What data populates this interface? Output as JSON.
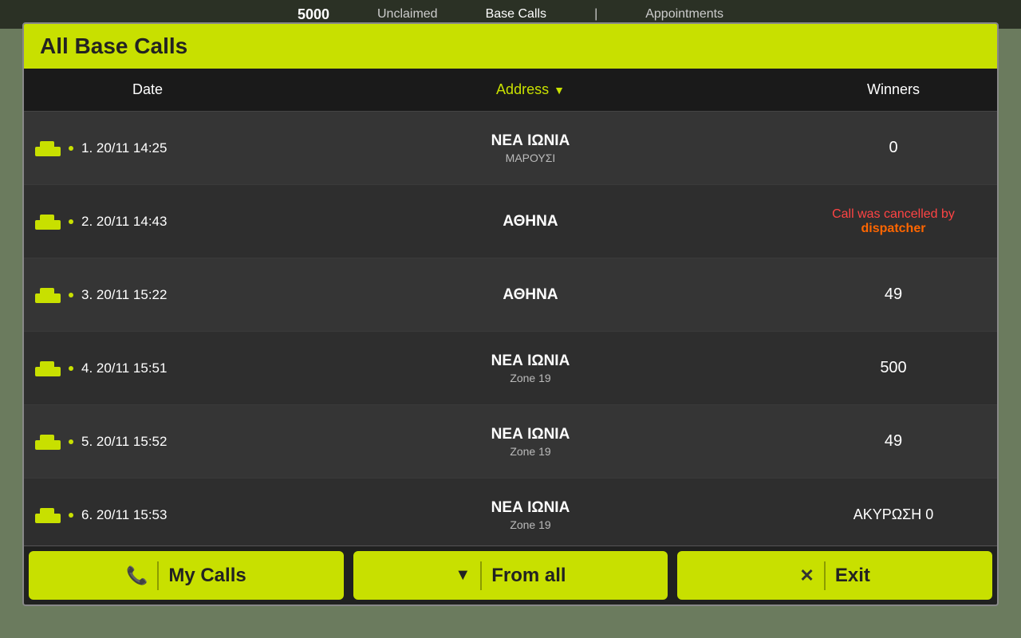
{
  "topNav": {
    "number": "5000",
    "items": [
      "Unclaimed",
      "Base Calls",
      "Appointments"
    ]
  },
  "panel": {
    "title": "All Base Calls",
    "columns": {
      "date": "Date",
      "address": "Address",
      "winners": "Winners"
    },
    "rows": [
      {
        "index": "1.",
        "date": "20/11 14:25",
        "addressMain": "ΝΕΑ ΙΩΝΙΑ",
        "addressSub": "ΜΑΡΟΥΣΙ",
        "winners": "0",
        "cancelled": false,
        "special": null
      },
      {
        "index": "2.",
        "date": "20/11 14:43",
        "addressMain": "ΑΘΗΝΑ",
        "addressSub": "",
        "winners": "",
        "cancelled": true,
        "cancelledText": "Call was cancelled by ",
        "cancelledBy": "dispatcher",
        "special": null
      },
      {
        "index": "3.",
        "date": "20/11 15:22",
        "addressMain": "ΑΘΗΝΑ",
        "addressSub": "",
        "winners": "49",
        "cancelled": false,
        "special": null
      },
      {
        "index": "4.",
        "date": "20/11 15:51",
        "addressMain": "ΝΕΑ ΙΩΝΙΑ",
        "addressSub": "Zone 19",
        "winners": "500",
        "cancelled": false,
        "special": null
      },
      {
        "index": "5.",
        "date": "20/11 15:52",
        "addressMain": "ΝΕΑ ΙΩΝΙΑ",
        "addressSub": "Zone 19",
        "winners": "49",
        "cancelled": false,
        "special": null
      },
      {
        "index": "6.",
        "date": "20/11 15:53",
        "addressMain": "ΝΕΑ ΙΩΝΙΑ",
        "addressSub": "Zone 19",
        "winners": "",
        "cancelled": false,
        "special": "ΑΚΥΡΩΣΗ 0"
      }
    ],
    "buttons": {
      "myCalls": "My Calls",
      "fromAll": "From all",
      "exit": "Exit"
    }
  }
}
